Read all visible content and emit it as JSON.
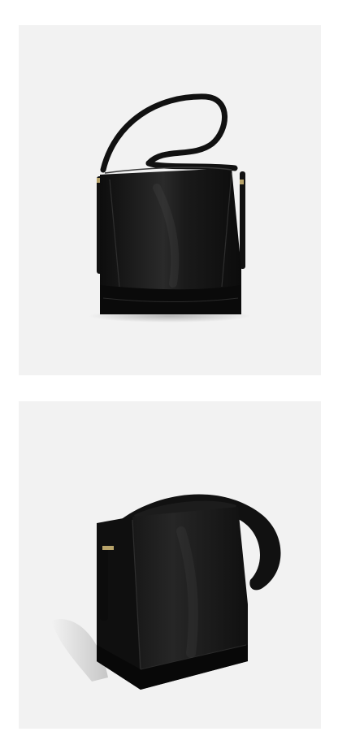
{
  "page": {
    "background_color": "#ffffff",
    "panel_color": "#f2f2f2"
  },
  "product": {
    "leather_color": "#141414",
    "hardware_color": "#b8a36a"
  },
  "photos": [
    {
      "view": "front"
    },
    {
      "view": "three-quarter"
    }
  ]
}
